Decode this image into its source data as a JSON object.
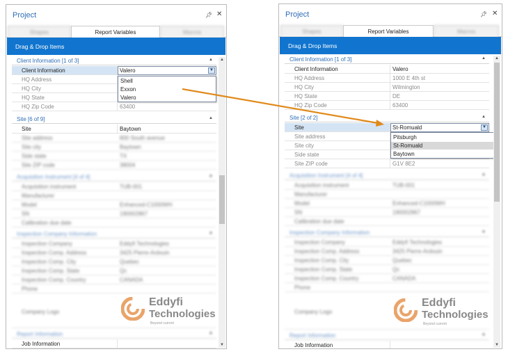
{
  "left_panel": {
    "title": "Project",
    "pin_icon": "pin-icon",
    "close_icon": "close-icon",
    "tabs": [
      "Shapes",
      "Report Variables",
      "Macros"
    ],
    "active_tab": "Report Variables",
    "banner": "Drag & Drop Items",
    "client_section": "Client Information [1 of 3]",
    "client_rows": [
      {
        "name": "Client Information",
        "value": "Valero"
      },
      {
        "name": "HQ Address",
        "value": ""
      },
      {
        "name": "HQ City",
        "value": ""
      },
      {
        "name": "HQ State",
        "value": ""
      },
      {
        "name": "HQ Zip Code",
        "value": "63400"
      }
    ],
    "dropdown_options": [
      "Shell",
      "Exxon",
      "Valero"
    ],
    "site_section": "Site [6 of 9]",
    "site_rows": [
      {
        "name": "Site",
        "value": "Baytown"
      },
      {
        "name": "Site address",
        "value": "800 South avenue"
      },
      {
        "name": "Site city",
        "value": "Baytown"
      },
      {
        "name": "Side state",
        "value": "TX"
      },
      {
        "name": "Site ZIP code",
        "value": "38004"
      }
    ],
    "acq_section": "Acquisition Instrument [4 of 4]",
    "acq_rows": [
      {
        "name": "Acquisition instrument",
        "value": "TUB-001"
      },
      {
        "name": "Manufacturer",
        "value": ""
      },
      {
        "name": "Model",
        "value": "Enhanced-C1000WH"
      },
      {
        "name": "SN",
        "value": "190002867"
      },
      {
        "name": "Calibration due date",
        "value": ""
      }
    ],
    "insp_section": "Inspection Company Information",
    "insp_rows": [
      {
        "name": "Inspection Company",
        "value": "Eddyfi Technologies"
      },
      {
        "name": "Inspection Comp. Address",
        "value": "3425 Pierre-Ardouin"
      },
      {
        "name": "Inspection Comp. City",
        "value": "Quebec"
      },
      {
        "name": "Inspection Comp. State",
        "value": "Qc"
      },
      {
        "name": "Inspection Comp. Country",
        "value": "CANADA"
      },
      {
        "name": "Phone",
        "value": ""
      },
      {
        "name": "Company Logo",
        "value": ""
      }
    ],
    "logo_line1": "Eddyfi",
    "logo_line2": "Technologies",
    "logo_sub": "Beyond current",
    "report_section": "Report Information",
    "report_rows": [
      {
        "name": "Job Information",
        "value": ""
      }
    ]
  },
  "right_panel": {
    "title": "Project",
    "pin_icon": "pin-icon",
    "close_icon": "close-icon",
    "tabs": [
      "Shapes",
      "Report Variables",
      "Macros"
    ],
    "active_tab": "Report Variables",
    "banner": "Drag & Drop Items",
    "client_section": "Client Information [1 of 3]",
    "client_rows": [
      {
        "name": "Client Information",
        "value": "Valero"
      },
      {
        "name": "HQ Address",
        "value": "1000 E 4th st"
      },
      {
        "name": "HQ City",
        "value": "Wilmington"
      },
      {
        "name": "HQ State",
        "value": "DE"
      },
      {
        "name": "HQ Zip Code",
        "value": "63400"
      }
    ],
    "site_section": "Site [2 of 2]",
    "site_rows": [
      {
        "name": "Site",
        "value": "St-Romuald"
      },
      {
        "name": "Site address",
        "value": ""
      },
      {
        "name": "Site city",
        "value": ""
      },
      {
        "name": "Side state",
        "value": ""
      },
      {
        "name": "Site ZIP code",
        "value": "G1V 8E2"
      }
    ],
    "dropdown_options": [
      "Pitsburgh",
      "St-Romuald",
      "Baytown"
    ],
    "dropdown_highlight": "St-Romuald",
    "acq_section": "Acquisition Instrument [4 of 4]",
    "acq_rows": [
      {
        "name": "Acquisition instrument",
        "value": "TUB-001"
      },
      {
        "name": "Manufacturer",
        "value": ""
      },
      {
        "name": "Model",
        "value": "Enhanced-C1000WH"
      },
      {
        "name": "SN",
        "value": "190002867"
      },
      {
        "name": "Calibration due date",
        "value": ""
      }
    ],
    "insp_section": "Inspection Company Information",
    "insp_rows": [
      {
        "name": "Inspection Company",
        "value": "Eddyfi Technologies"
      },
      {
        "name": "Inspection Comp. Address",
        "value": "3425 Pierre-Ardouin"
      },
      {
        "name": "Inspection Comp. City",
        "value": "Quebec"
      },
      {
        "name": "Inspection Comp. State",
        "value": "Qc"
      },
      {
        "name": "Inspection Comp. Country",
        "value": "CANADA"
      },
      {
        "name": "Phone",
        "value": ""
      },
      {
        "name": "Company Logo",
        "value": ""
      }
    ],
    "logo_line1": "Eddyfi",
    "logo_line2": "Technologies",
    "logo_sub": "Beyond current",
    "report_section": "Report Information",
    "report_rows": [
      {
        "name": "Job Information",
        "value": ""
      }
    ]
  },
  "colors": {
    "accent": "#1175cf",
    "arrow": "#e08a1a",
    "section_text": "#2e6db5",
    "selected_row": "#d4e4f4"
  }
}
